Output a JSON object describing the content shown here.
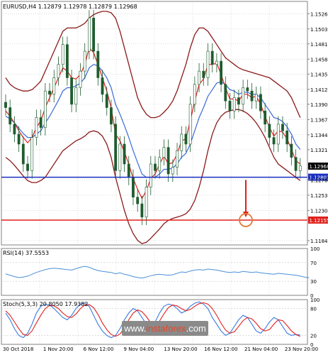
{
  "colors": {
    "background": "#ffffff",
    "grid": "#c8c8c8",
    "candle": "#1f5c2e",
    "bollinger": "#8b1a1a",
    "ma_red": "#e02020",
    "ma_blue": "#3a6ad8",
    "support_line": "#1a2fbf",
    "target_line": "#e0201a",
    "rsi_line": "#4a90d9",
    "stoch_main": "#3b7be0",
    "stoch_signal": "#e02020",
    "arrow": "#e0201a"
  },
  "watermark": {
    "text_prefix": "www.",
    "text_brand": "instaforex",
    "text_suffix": ".com"
  },
  "chart_data": [
    {
      "type": "candlestick",
      "title": "EURUSD,H4  1.12879 1.12978 1.12879 1.12968",
      "instrument": "EURUSD,H4",
      "ohlc_header": "1.12879 1.12978 1.12879 1.12968",
      "ylim": [
        1.1178,
        1.1545
      ],
      "price_ticks": [
        {
          "label": "1.15265",
          "value": 1.15265
        },
        {
          "label": "1.15035",
          "value": 1.15035
        },
        {
          "label": "1.14810",
          "value": 1.1481
        },
        {
          "label": "1.14580",
          "value": 1.1458
        },
        {
          "label": "1.14355",
          "value": 1.14355
        },
        {
          "label": "1.14125",
          "value": 1.14125
        },
        {
          "label": "1.13900",
          "value": 1.139
        },
        {
          "label": "1.13670",
          "value": 1.1367
        },
        {
          "label": "1.13440",
          "value": 1.1344
        },
        {
          "label": "1.13215",
          "value": 1.13215
        },
        {
          "label": "1.12760",
          "value": 1.1276
        },
        {
          "label": "1.12530",
          "value": 1.1253
        },
        {
          "label": "1.12300",
          "value": 1.123
        },
        {
          "label": "1.11845",
          "value": 1.11845
        }
      ],
      "current_price": {
        "label": "1.12968",
        "value": 1.12968
      },
      "levels": [
        {
          "label": "1.12801",
          "value": 1.12801,
          "color": "#1a2fbf"
        },
        {
          "label": "1.12155",
          "value": 1.12155,
          "color": "#e0201a"
        }
      ],
      "forecast_arrow": {
        "from_value": 1.1276,
        "to_value": 1.12155
      },
      "x_labels": [
        "30 Oct 2018",
        "1 Nov 20:00",
        "6 Nov 12:00",
        "9 Nov 04:00",
        "13 Nov 20:00",
        "16 Nov 12:00",
        "21 Nov 04:00",
        "23 Nov 20:00"
      ],
      "closes": [
        1.1385,
        1.136,
        1.1345,
        1.133,
        1.13,
        1.129,
        1.134,
        1.137,
        1.1355,
        1.141,
        1.1405,
        1.143,
        1.145,
        1.148,
        1.143,
        1.139,
        1.1415,
        1.144,
        1.147,
        1.152,
        1.147,
        1.143,
        1.1405,
        1.1385,
        1.136,
        1.129,
        1.133,
        1.13,
        1.128,
        1.125,
        1.124,
        1.122,
        1.1265,
        1.13,
        1.129,
        1.131,
        1.1325,
        1.1285,
        1.1295,
        1.132,
        1.1345,
        1.133,
        1.139,
        1.142,
        1.144,
        1.143,
        1.147,
        1.145,
        1.1455,
        1.142,
        1.1395,
        1.138,
        1.14,
        1.139,
        1.1415,
        1.141,
        1.1395,
        1.1405,
        1.138,
        1.136,
        1.134,
        1.133,
        1.136,
        1.135,
        1.133,
        1.131,
        1.129,
        1.1297
      ],
      "moving_average_fast": [
        1.138,
        1.1372,
        1.1362,
        1.135,
        1.134,
        1.1332,
        1.134,
        1.1355,
        1.1365,
        1.1385,
        1.14,
        1.1415,
        1.143,
        1.1445,
        1.144,
        1.143,
        1.1428,
        1.1435,
        1.145,
        1.1475,
        1.1468,
        1.145,
        1.143,
        1.141,
        1.1385,
        1.1345,
        1.1335,
        1.1318,
        1.13,
        1.1278,
        1.1262,
        1.1248,
        1.126,
        1.1278,
        1.1285,
        1.13,
        1.1312,
        1.13,
        1.1302,
        1.1315,
        1.1335,
        1.1338,
        1.1365,
        1.1395,
        1.142,
        1.1428,
        1.145,
        1.145,
        1.1452,
        1.1435,
        1.1415,
        1.1398,
        1.1398,
        1.1395,
        1.1405,
        1.1405,
        1.14,
        1.1402,
        1.139,
        1.1372,
        1.1355,
        1.1342,
        1.135,
        1.1348,
        1.1338,
        1.1322,
        1.1305,
        1.13
      ],
      "moving_average_slow": [
        1.1372,
        1.1368,
        1.1362,
        1.1354,
        1.1346,
        1.134,
        1.134,
        1.1345,
        1.135,
        1.1362,
        1.1372,
        1.1384,
        1.1396,
        1.141,
        1.1415,
        1.1415,
        1.1418,
        1.1422,
        1.143,
        1.1445,
        1.145,
        1.1448,
        1.144,
        1.143,
        1.1415,
        1.139,
        1.1375,
        1.1358,
        1.134,
        1.132,
        1.1302,
        1.1285,
        1.128,
        1.128,
        1.128,
        1.1285,
        1.1292,
        1.1292,
        1.1294,
        1.13,
        1.131,
        1.1316,
        1.133,
        1.135,
        1.137,
        1.1385,
        1.1402,
        1.1412,
        1.1422,
        1.1424,
        1.142,
        1.1412,
        1.141,
        1.1405,
        1.1408,
        1.1408,
        1.1405,
        1.1405,
        1.14,
        1.139,
        1.138,
        1.137,
        1.1368,
        1.1364,
        1.1356,
        1.1345,
        1.133,
        1.1322
      ],
      "bollinger_upper": [
        1.143,
        1.142,
        1.1415,
        1.1412,
        1.141,
        1.141,
        1.1412,
        1.1418,
        1.1425,
        1.144,
        1.1455,
        1.147,
        1.1485,
        1.15,
        1.1505,
        1.1505,
        1.1505,
        1.1508,
        1.1512,
        1.152,
        1.1525,
        1.1528,
        1.153,
        1.153,
        1.1528,
        1.152,
        1.15,
        1.1475,
        1.145,
        1.1425,
        1.14,
        1.1385,
        1.1375,
        1.137,
        1.137,
        1.1372,
        1.1378,
        1.1385,
        1.1395,
        1.141,
        1.143,
        1.145,
        1.1475,
        1.1495,
        1.1505,
        1.1505,
        1.15,
        1.149,
        1.148,
        1.147,
        1.146,
        1.1455,
        1.145,
        1.1445,
        1.1442,
        1.144,
        1.1438,
        1.1436,
        1.1434,
        1.1432,
        1.143,
        1.1425,
        1.142,
        1.1415,
        1.141,
        1.14,
        1.1385,
        1.137
      ],
      "bollinger_lower": [
        1.131,
        1.1305,
        1.1298,
        1.129,
        1.1282,
        1.1275,
        1.1272,
        1.1272,
        1.1275,
        1.128,
        1.129,
        1.13,
        1.131,
        1.132,
        1.1325,
        1.133,
        1.1335,
        1.1338,
        1.1342,
        1.1348,
        1.135,
        1.1348,
        1.1342,
        1.133,
        1.131,
        1.128,
        1.1255,
        1.123,
        1.121,
        1.1195,
        1.1185,
        1.118,
        1.1182,
        1.1188,
        1.1195,
        1.1202,
        1.121,
        1.1215,
        1.1218,
        1.122,
        1.1222,
        1.1225,
        1.1232,
        1.1245,
        1.1265,
        1.129,
        1.132,
        1.1345,
        1.1362,
        1.1372,
        1.1378,
        1.138,
        1.1382,
        1.1382,
        1.138,
        1.1376,
        1.137,
        1.1362,
        1.1352,
        1.134,
        1.1325,
        1.131,
        1.13,
        1.1295,
        1.129,
        1.1285,
        1.128,
        1.1275
      ]
    },
    {
      "type": "line",
      "title": "RSI(14) 37.5553",
      "ylim": [
        0,
        100
      ],
      "y_ticks": [
        {
          "label": "100",
          "value": 100
        },
        {
          "label": "70",
          "value": 70
        },
        {
          "label": "30",
          "value": 30
        },
        {
          "label": "0",
          "value": 0
        }
      ],
      "values": [
        46,
        43,
        40,
        38,
        39,
        41,
        45,
        49,
        52,
        55,
        57,
        58,
        57,
        56,
        55,
        54,
        57,
        60,
        62,
        60,
        56,
        53,
        51,
        50,
        49,
        46,
        48,
        45,
        43,
        40,
        38,
        37,
        39,
        42,
        44,
        45,
        44,
        43,
        44,
        47,
        50,
        49,
        52,
        54,
        55,
        54,
        56,
        55,
        54,
        52,
        50,
        49,
        50,
        49,
        51,
        50,
        49,
        50,
        48,
        47,
        46,
        45,
        47,
        46,
        45,
        44,
        43,
        41,
        39,
        37.5553
      ]
    },
    {
      "type": "line",
      "title": "Stoch(5,3,3) 20.8050 17.9382",
      "ylim": [
        0,
        100
      ],
      "y_ticks": [
        {
          "label": "100",
          "value": 100
        },
        {
          "label": "80",
          "value": 80
        },
        {
          "label": "20",
          "value": 20
        },
        {
          "label": "0",
          "value": 0
        }
      ],
      "series": [
        {
          "values": [
            70,
            55,
            35,
            20,
            15,
            25,
            45,
            70,
            85,
            90,
            88,
            80,
            70,
            60,
            55,
            65,
            80,
            90,
            92,
            85,
            65,
            45,
            30,
            20,
            15,
            20,
            35,
            55,
            70,
            80,
            75,
            60,
            45,
            35,
            50,
            70,
            85,
            90,
            88,
            80,
            70,
            75,
            85,
            92,
            95,
            90,
            80,
            60,
            45,
            30,
            20,
            25,
            40,
            55,
            65,
            60,
            45,
            30,
            25,
            35,
            50,
            60,
            55,
            40,
            25,
            20,
            22,
            20.805
          ]
        },
        {
          "values": [
            75,
            65,
            50,
            35,
            22,
            20,
            30,
            48,
            65,
            80,
            87,
            86,
            80,
            70,
            62,
            60,
            68,
            80,
            88,
            89,
            82,
            67,
            48,
            33,
            22,
            18,
            23,
            37,
            55,
            70,
            77,
            73,
            62,
            48,
            42,
            52,
            68,
            82,
            88,
            86,
            80,
            75,
            78,
            85,
            91,
            93,
            90,
            80,
            65,
            47,
            32,
            25,
            28,
            40,
            53,
            60,
            57,
            47,
            35,
            30,
            33,
            45,
            55,
            53,
            42,
            30,
            22,
            17.9382
          ]
        }
      ]
    }
  ]
}
